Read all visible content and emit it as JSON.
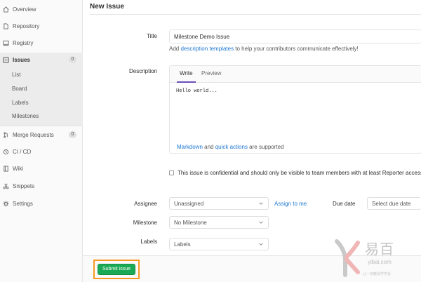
{
  "sidebar": {
    "items": [
      {
        "label": "Overview",
        "icon": "home-icon"
      },
      {
        "label": "Repository",
        "icon": "document-icon"
      },
      {
        "label": "Registry",
        "icon": "monitor-icon"
      },
      {
        "label": "Issues",
        "icon": "issues-icon",
        "badge": "0",
        "active": true
      },
      {
        "label": "Merge Requests",
        "icon": "merge-request-icon",
        "badge": "0"
      },
      {
        "label": "CI / CD",
        "icon": "rocket-icon"
      },
      {
        "label": "Wiki",
        "icon": "book-icon"
      },
      {
        "label": "Snippets",
        "icon": "scissors-icon"
      },
      {
        "label": "Settings",
        "icon": "gear-icon"
      }
    ],
    "issue_subitems": [
      "List",
      "Board",
      "Labels",
      "Milestones"
    ]
  },
  "main": {
    "title": "New Issue",
    "title_field": {
      "label": "Title",
      "value": "Milestone Demo Issue"
    },
    "help": {
      "prefix": "Add ",
      "link": "description templates",
      "suffix": " to help your contributors communicate effectively!"
    },
    "description": {
      "label": "Description",
      "tabs": [
        "Write",
        "Preview"
      ],
      "content": "Hello world...",
      "footer": {
        "link1": "Markdown",
        "mid": " and ",
        "link2": "quick actions",
        "suffix": " are supported"
      }
    },
    "confidential": "This issue is confidential and should only be visible to team members with at least Reporter access.",
    "assignee": {
      "label": "Assignee",
      "value": "Unassigned",
      "assign_link": "Assign to me"
    },
    "due_date": {
      "label": "Due date",
      "placeholder": "Select due date"
    },
    "milestone": {
      "label": "Milestone",
      "value": "No Milestone"
    },
    "labels": {
      "label": "Labels",
      "value": "Labels"
    },
    "submit": "Submit issue"
  },
  "watermark": {
    "cn": "易百",
    "en": "yibai.com",
    "small": "让一切教易学学会"
  },
  "colors": {
    "accent": "#6b4fbb",
    "link": "#1f78d1",
    "submit": "#1aaa55",
    "highlight": "#f59a23"
  }
}
